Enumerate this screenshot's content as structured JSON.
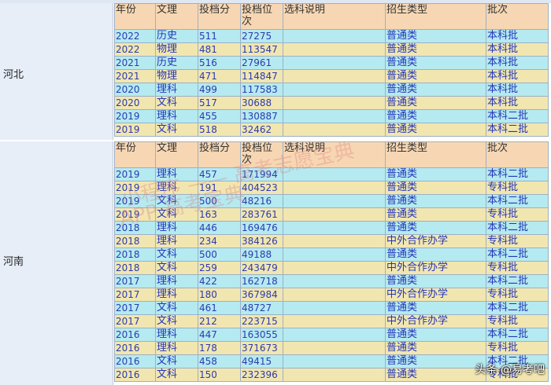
{
  "headers": [
    "年份",
    "文理",
    "投档分",
    "投档位次",
    "选科说明",
    "招生类型",
    "批次"
  ],
  "hebei": {
    "province": "河北",
    "rows": [
      [
        "2022",
        "历史",
        "511",
        "27275",
        "",
        "普通类",
        "本科批"
      ],
      [
        "2022",
        "物理",
        "481",
        "113547",
        "",
        "普通类",
        "本科批"
      ],
      [
        "2021",
        "历史",
        "516",
        "27961",
        "",
        "普通类",
        "本科批"
      ],
      [
        "2021",
        "物理",
        "471",
        "114847",
        "",
        "普通类",
        "本科批"
      ],
      [
        "2020",
        "理科",
        "499",
        "117583",
        "",
        "普通类",
        "本科批"
      ],
      [
        "2020",
        "文科",
        "517",
        "30688",
        "",
        "普通类",
        "本科批"
      ],
      [
        "2019",
        "理科",
        "455",
        "130887",
        "",
        "普通类",
        "本科二批"
      ],
      [
        "2019",
        "文科",
        "518",
        "32462",
        "",
        "普通类",
        "本科二批"
      ]
    ]
  },
  "henan": {
    "province": "河南",
    "rows": [
      [
        "2019",
        "理科",
        "457",
        "171994",
        "",
        "普通类",
        "本科二批"
      ],
      [
        "2019",
        "理科",
        "191",
        "404523",
        "",
        "普通类",
        "专科批"
      ],
      [
        "2019",
        "文科",
        "500",
        "48216",
        "",
        "普通类",
        "本科二批"
      ],
      [
        "2019",
        "文科",
        "163",
        "283761",
        "",
        "普通类",
        "专科批"
      ],
      [
        "2018",
        "理科",
        "446",
        "169476",
        "",
        "普通类",
        "本科二批"
      ],
      [
        "2018",
        "理科",
        "234",
        "384126",
        "",
        "中外合作办学",
        "专科批"
      ],
      [
        "2018",
        "文科",
        "500",
        "49188",
        "",
        "普通类",
        "本科二批"
      ],
      [
        "2018",
        "文科",
        "259",
        "243479",
        "",
        "中外合作办学",
        "专科批"
      ],
      [
        "2017",
        "理科",
        "422",
        "162718",
        "",
        "普通类",
        "本科二批"
      ],
      [
        "2017",
        "理科",
        "180",
        "367984",
        "",
        "中外合作办学",
        "专科批"
      ],
      [
        "2017",
        "文科",
        "461",
        "48727",
        "",
        "普通类",
        "本科二批"
      ],
      [
        "2017",
        "文科",
        "212",
        "223715",
        "",
        "中外合作办学",
        "专科批"
      ],
      [
        "2016",
        "理科",
        "447",
        "163055",
        "",
        "普通类",
        "本科二批"
      ],
      [
        "2016",
        "理科",
        "178",
        "371673",
        "",
        "普通类",
        "专科批"
      ],
      [
        "2016",
        "文科",
        "458",
        "49415",
        "",
        "普通类",
        "本科二批"
      ],
      [
        "2016",
        "文科",
        "150",
        "232396",
        "",
        "普通类",
        "专科批"
      ]
    ]
  },
  "watermark": {
    "line1": "小程序 —— 高考志愿宝典",
    "line2": "APP 高考宝典"
  },
  "credit": "头条 @易考吧"
}
